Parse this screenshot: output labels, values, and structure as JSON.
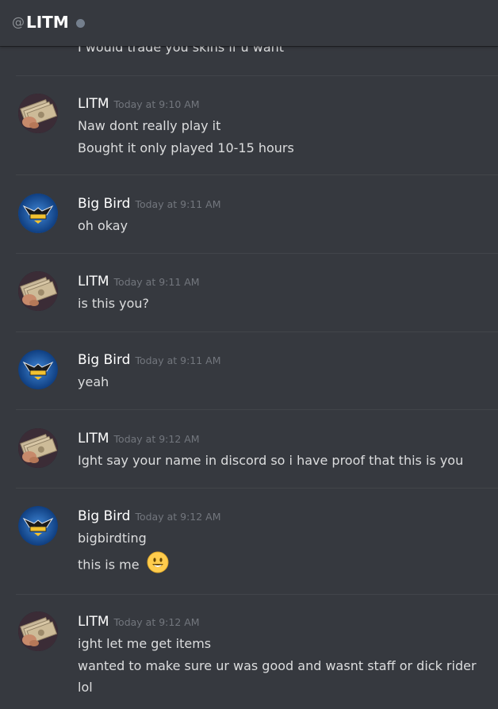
{
  "header": {
    "at_symbol": "@",
    "channel_name": "LITM",
    "status": "offline"
  },
  "cutoff_message": "I would trade you skins if u want",
  "groups": [
    {
      "username": "LITM",
      "avatar": "money-hand-avatar",
      "timestamp": "Today at 9:10 AM",
      "messages": [
        "Naw dont really play it",
        "Bought it only played 10-15 hours"
      ]
    },
    {
      "username": "Big Bird",
      "avatar": "eagle-logo-avatar",
      "timestamp": "Today at 9:11 AM",
      "messages": [
        "oh okay"
      ]
    },
    {
      "username": "LITM",
      "avatar": "money-hand-avatar",
      "timestamp": "Today at 9:11 AM",
      "messages": [
        "is this you?"
      ]
    },
    {
      "username": "Big Bird",
      "avatar": "eagle-logo-avatar",
      "timestamp": "Today at 9:11 AM",
      "messages": [
        "yeah"
      ]
    },
    {
      "username": "LITM",
      "avatar": "money-hand-avatar",
      "timestamp": "Today at 9:12 AM",
      "messages": [
        "Ight say your name in discord so i have proof that this is you"
      ]
    },
    {
      "username": "Big Bird",
      "avatar": "eagle-logo-avatar",
      "timestamp": "Today at 9:12 AM",
      "messages": [
        "bigbirdting",
        "this is me"
      ],
      "emoji": "smiley-emoji"
    },
    {
      "username": "LITM",
      "avatar": "money-hand-avatar",
      "timestamp": "Today at 9:12 AM",
      "messages": [
        "ight let me get items",
        "wanted to make sure ur was good and wasnt staff or dick rider",
        "lol"
      ]
    }
  ],
  "colors": {
    "background": "#36393f",
    "username": "#ffffff",
    "timestamp": "#72767d",
    "message_text": "#dcddde",
    "divider": "#42454a",
    "status_offline": "#747f8d",
    "bigbird_avatar_bg": "#1d5fb0"
  }
}
